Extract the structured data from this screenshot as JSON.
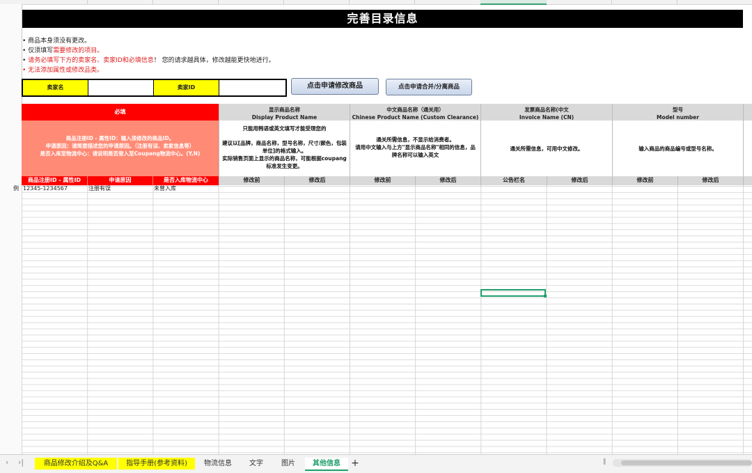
{
  "title": "完善目录信息",
  "notes": {
    "n1": "商品本身须没有更改。",
    "n2a": "仅须填写",
    "n2b": "需要修改的项目。",
    "n3a": "请",
    "n3b": "务必填写下方的卖家名、卖家ID和必填信息",
    "n3c": "！ 您的请求越具体，修改越能更快地进行。",
    "n4": "无法添加属性或修改品类。"
  },
  "seller": {
    "name_label": "卖家名",
    "name_value": "",
    "id_label": "卖家ID",
    "id_value": ""
  },
  "buttons": {
    "modify": "点击申请修改商品",
    "merge": "点击申请合并/分离商品"
  },
  "header": {
    "required": "必填",
    "required_desc1": "商品注册ID - 属性ID：输入须修改的商品ID。",
    "required_desc2": "申请原因：请简要描述您的申请原因。（注册有误、卖家信息等）",
    "required_desc3": "是否入库至物流中心：请说明是否登入至Coupang物流中心。(Y,N)",
    "col_display_cn": "显示商品名称",
    "col_display_en": "Display Product Name",
    "col_display_desc1": "只能用韩语或英文填写才能受理您的",
    "col_display_desc2": "建议以[品牌，商品名称，型号名称，尺寸/颜色，包装单位]的格式输入。",
    "col_display_desc3": "实际销售页面上显示的商品名称，可能根据coupang标准发生变更。",
    "col_chinese_cn": "中文商品名称（通关用）",
    "col_chinese_en": "Chinese Product Name (Custom Clearance)",
    "col_chinese_desc1": "通关所需信息，不显示给消费者。",
    "col_chinese_desc2": "请用中文输入与上方\"显示商品名称\"相同的信息，品牌名称可以输入英文",
    "col_invoice_cn": "发票商品名称(中文",
    "col_invoice_en": "Invoice Name (CN)",
    "col_invoice_desc": "通关所需信息，可用中文修改。",
    "col_model_cn": "型号",
    "col_model_en": "Model number",
    "col_model_desc": "输入商品的商品编号或型号名称。"
  },
  "subheaders": {
    "id": "商品注册ID - 属性ID",
    "reason": "申请原因",
    "warehouse": "是否入库物流中心",
    "before": "修改前",
    "after": "修改后",
    "notice": "公告栏名"
  },
  "example": {
    "label": "例",
    "id": "12345-1234567",
    "reason": "注册有误",
    "warehouse": "未曾入库"
  },
  "sheet_tabs": {
    "t1": "商品修改介绍及Q&A",
    "t2": "指导手册(参考资料)",
    "t3": "物流信息",
    "t4": "文字",
    "t5": "图片",
    "t6": "其他信息",
    "add": "+"
  },
  "colors": {
    "required": "#ff0000",
    "required_desc": "#ff8a75",
    "header_grey": "#d9d9d9",
    "seller_label": "#ffff00",
    "active_tab": "#1e9f6a"
  }
}
